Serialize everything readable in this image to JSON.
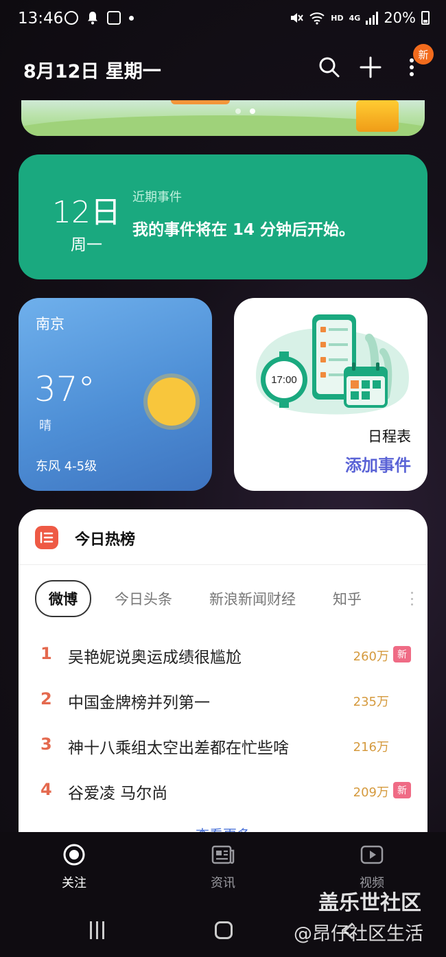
{
  "status_bar": {
    "time": "13:46",
    "network_label": "HD",
    "signal_label": "4G",
    "battery": "20%"
  },
  "header": {
    "date": "8月12日 星期一",
    "new_badge": "新",
    "icons": [
      "search-icon",
      "add-icon",
      "more-icon"
    ]
  },
  "event_card": {
    "day": "12日",
    "weekday": "周一",
    "label": "近期事件",
    "text": "我的事件将在 14 分钟后开始。",
    "color": "#1aa97f"
  },
  "weather": {
    "city": "南京",
    "temperature": "37°",
    "condition": "晴",
    "wind": "东风 4-5级"
  },
  "schedule": {
    "clock_time": "17:00",
    "title": "日程表",
    "add_label": "添加事件",
    "accent": "#5a63d6"
  },
  "hot_list": {
    "title": "今日热榜",
    "tabs": [
      "微博",
      "今日头条",
      "新浪新闻财经",
      "知乎"
    ],
    "active_tab": "微博",
    "items": [
      {
        "rank": "1",
        "text": "吴艳妮说奥运成绩很尴尬",
        "count": "260万",
        "badge": "新"
      },
      {
        "rank": "2",
        "text": "中国金牌榜并列第一",
        "count": "235万",
        "badge": ""
      },
      {
        "rank": "3",
        "text": "神十八乘组太空出差都在忙些啥",
        "count": "216万",
        "badge": ""
      },
      {
        "rank": "4",
        "text": "谷爱凌 马尔尚",
        "count": "209万",
        "badge": "新"
      }
    ],
    "more_label": "查看更多"
  },
  "bottom_nav": {
    "items": [
      {
        "label": "关注",
        "icon": "target-icon",
        "active": true
      },
      {
        "label": "资讯",
        "icon": "news-icon",
        "active": false
      },
      {
        "label": "视频",
        "icon": "play-icon",
        "active": false
      }
    ]
  },
  "watermark": {
    "line1": "盖乐世社区",
    "line2": "@昂仔社区生活"
  }
}
